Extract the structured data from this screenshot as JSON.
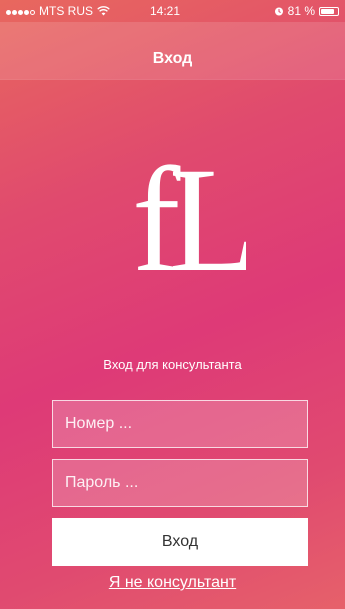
{
  "status_bar": {
    "carrier": "MTS RUS",
    "time": "14:21",
    "battery": "81 %",
    "battery_level": 0.81,
    "signal_bars": 4,
    "signal_max": 5
  },
  "nav": {
    "title": "Вход"
  },
  "logo": {
    "text": "fL"
  },
  "login": {
    "subtitle": "Вход для консультанта",
    "number_placeholder": "Номер ...",
    "password_placeholder": "Пароль ...",
    "submit_label": "Вход",
    "not_consultant_link": "Я не консультант"
  },
  "icons": {
    "wifi": "wifi-icon",
    "alarm": "alarm-icon",
    "battery": "battery-icon"
  },
  "colors": {
    "gradient_top": "#e8685e",
    "gradient_mid": "#de3a77",
    "gradient_bottom": "#e6616a",
    "text": "#ffffff",
    "button_bg": "#ffffff",
    "button_text": "#333333"
  }
}
